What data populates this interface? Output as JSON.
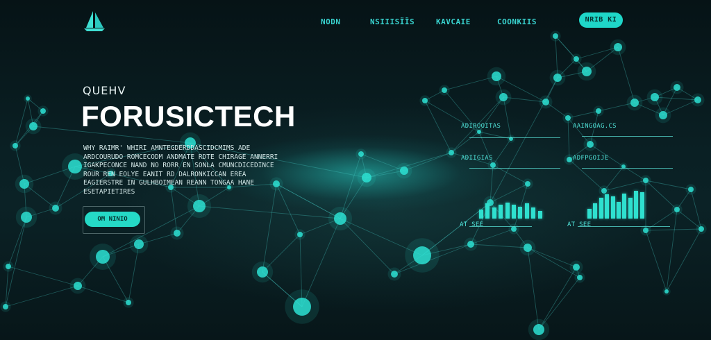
{
  "nav": {
    "items": [
      {
        "label": "NODN"
      },
      {
        "label": "NSIIISÏÏS"
      },
      {
        "label": "KAVCAIE"
      },
      {
        "label": "COONKIIS"
      }
    ],
    "signup_label": "NRIB KI"
  },
  "hero": {
    "eyebrow": "QUEHV",
    "title": "FORUSICTECH",
    "body": "WHY RAIMR' WHIRI AMNTEGDERDDASCIDCMIMS ADE ARDCOURUDO ROMCECODM ANDMATE RDTE CHIRAGE ANNERRI IGAKPECONCE NAND NO RORR EN SONLA CMUNCDICEDINCE ROUR REN EOLYE EANIT RD DALRONKICCAN EREA EAGIERSTRE IN GULHBOIMEAN REANN TONGAA HANE ESETAPIETIRES",
    "cta_label": "OM NINIO"
  },
  "stats": {
    "panels": [
      {
        "label": "ADIROOITAS"
      },
      {
        "label": "AAINGOAG.CS"
      },
      {
        "label": "ADIIGIAS"
      },
      {
        "label": "ADFPGOIJE"
      }
    ],
    "charts": [
      {
        "label": "AT SEE",
        "values": [
          0.55,
          0.9,
          0.68,
          0.84,
          0.95,
          0.84,
          0.7,
          0.9,
          0.65,
          0.45
        ]
      },
      {
        "label": "AT SEE",
        "values": [
          0.36,
          0.55,
          0.75,
          0.88,
          0.8,
          0.6,
          0.9,
          0.75,
          1.0,
          0.94
        ]
      }
    ]
  },
  "colors": {
    "accent": "#25d9c6",
    "background": "#07191c"
  }
}
